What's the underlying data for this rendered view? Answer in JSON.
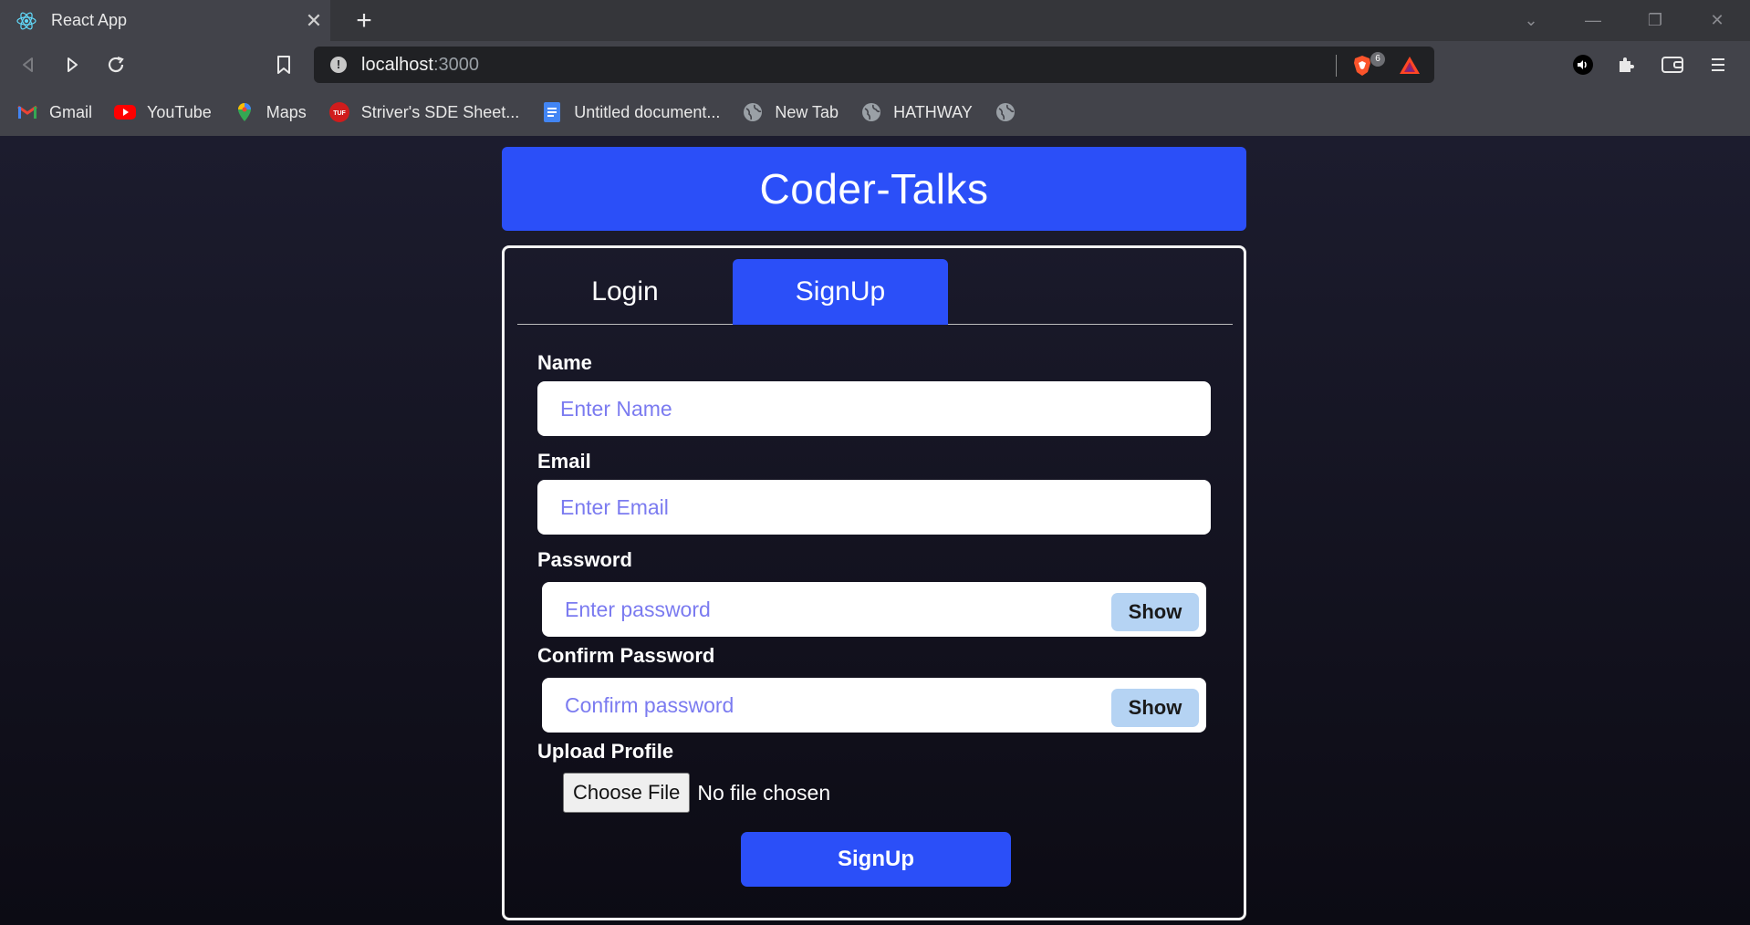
{
  "browser": {
    "tab_title": "React App",
    "tab_close": "✕",
    "new_tab": "+",
    "url_host": "localhost",
    "url_port": ":3000",
    "shield_count": "6",
    "win_min": "—",
    "win_restore": "❐",
    "win_close": "✕",
    "tab_menu": "⌄"
  },
  "bookmarks": [
    {
      "label": "Gmail",
      "icon": "gmail-icon"
    },
    {
      "label": "YouTube",
      "icon": "youtube-icon"
    },
    {
      "label": "Maps",
      "icon": "maps-icon"
    },
    {
      "label": "Striver's SDE Sheet...",
      "icon": "tuf-icon"
    },
    {
      "label": "Untitled document...",
      "icon": "docs-icon"
    },
    {
      "label": "New Tab",
      "icon": "globe-icon"
    },
    {
      "label": "HATHWAY",
      "icon": "globe-icon"
    },
    {
      "label": "",
      "icon": "globe-icon"
    }
  ],
  "app": {
    "brand": "Coder-Talks",
    "tabs": [
      {
        "label": "Login",
        "active": false
      },
      {
        "label": "SignUp",
        "active": true
      }
    ],
    "form": {
      "name_label": "Name",
      "name_placeholder": "Enter Name",
      "email_label": "Email",
      "email_placeholder": "Enter Email",
      "password_label": "Password",
      "password_placeholder": "Enter password",
      "confirm_label": "Confirm Password",
      "confirm_placeholder": "Confirm password",
      "show_label": "Show",
      "upload_label": "Upload Profile",
      "file_button": "Choose File",
      "file_status": "No file chosen",
      "submit_label": "SignUp"
    }
  },
  "colors": {
    "accent": "#2b4ff8",
    "show_button": "#b5d3f3",
    "placeholder": "#7b7bf0"
  }
}
